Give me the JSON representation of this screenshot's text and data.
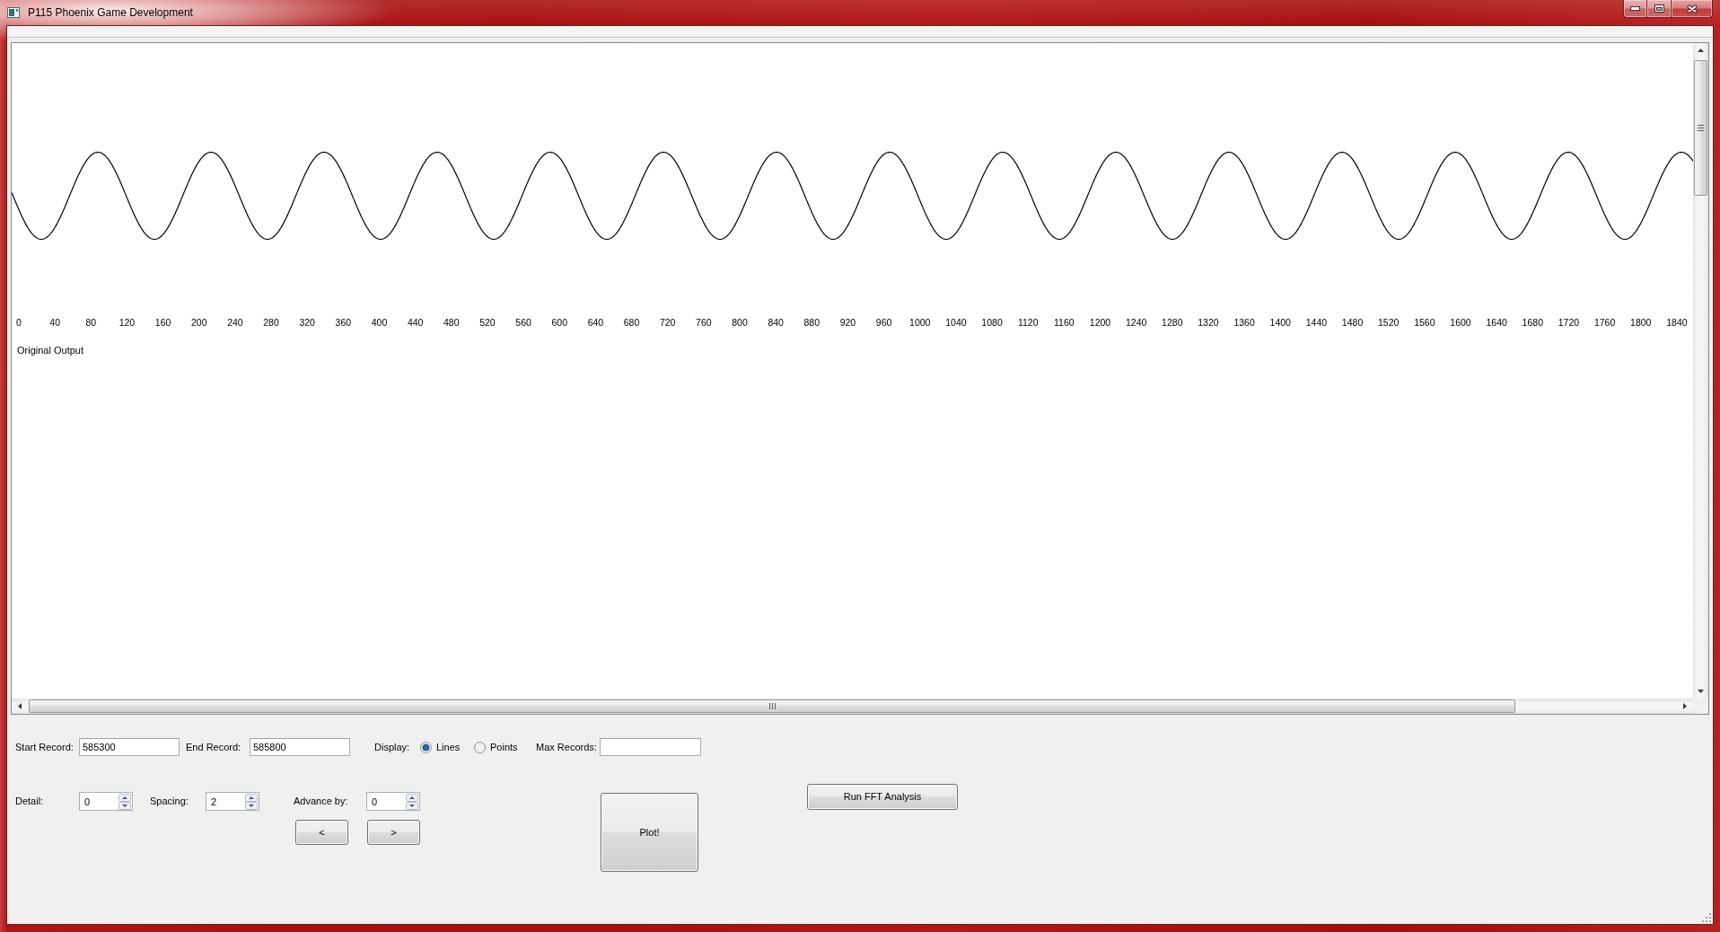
{
  "window": {
    "title": "P115 Phoenix Game Development"
  },
  "plot": {
    "axis_labels": [
      "0",
      "40",
      "80",
      "120",
      "160",
      "200",
      "240",
      "280",
      "320",
      "360",
      "400",
      "440",
      "480",
      "520",
      "560",
      "600",
      "640",
      "680",
      "720",
      "760",
      "800",
      "840",
      "880",
      "920",
      "960",
      "1000",
      "1040",
      "1080",
      "1120",
      "1160",
      "1200",
      "1240",
      "1280",
      "1320",
      "1360",
      "1400",
      "1440",
      "1480",
      "1520",
      "1560",
      "1600",
      "1640",
      "1680",
      "1720",
      "1760",
      "1800",
      "1840"
    ],
    "caption": "Original Output"
  },
  "controls": {
    "start_record": {
      "label": "Start Record:",
      "value": "585300"
    },
    "end_record": {
      "label": "End Record:",
      "value": "585800"
    },
    "display": {
      "label": "Display:",
      "options": [
        {
          "label": "Lines",
          "selected": true
        },
        {
          "label": "Points",
          "selected": false
        }
      ]
    },
    "max_records": {
      "label": "Max Records:"
    },
    "detail": {
      "label": "Detail:",
      "value": "0"
    },
    "spacing": {
      "label": "Spacing:",
      "value": "2"
    },
    "advance_by": {
      "label": "Advance by:",
      "value": "0"
    },
    "prev_button": "<",
    "next_button": ">",
    "plot_button": "Plot!",
    "fft_button": "Run FFT Analysis"
  }
}
